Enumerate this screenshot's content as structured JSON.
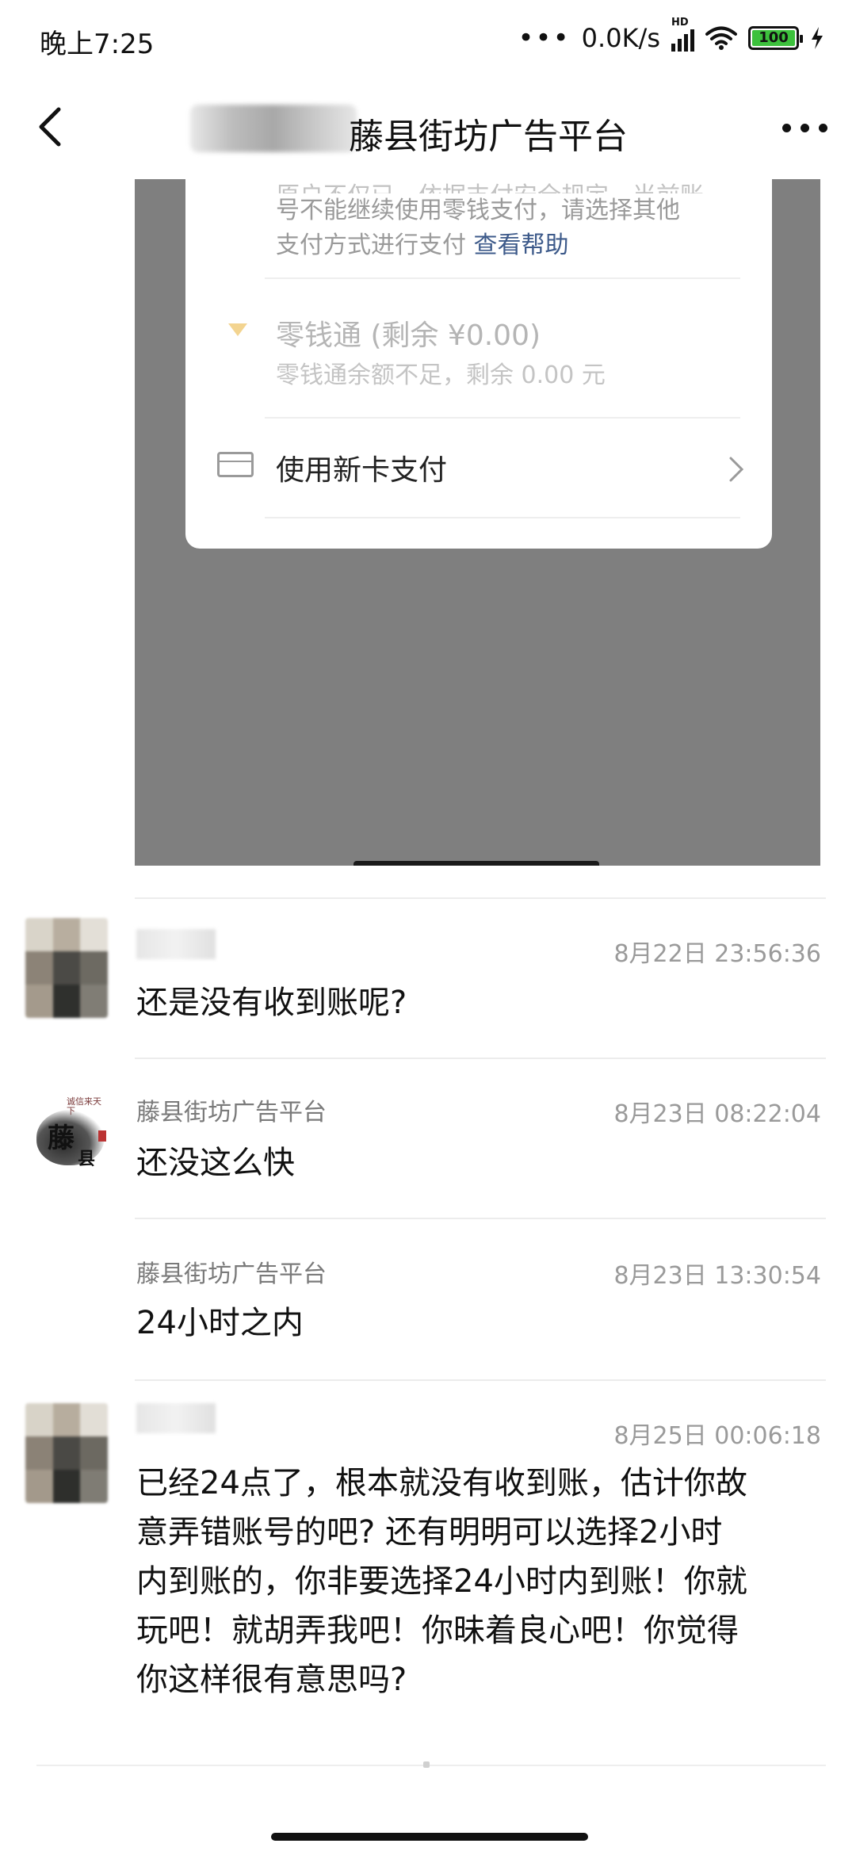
{
  "status_bar": {
    "time": "晚上7:25",
    "dots": "•••",
    "network_speed": "0.0K/s",
    "hd_tag": "HD",
    "battery": "100"
  },
  "header": {
    "title": "藤县街坊广告平台"
  },
  "embedded_screenshot": {
    "partial_line": "原户不仅已，依据支付安全规定，当前账",
    "notice_line_1": "号不能继续使用零钱支付，请选择其他",
    "notice_line_2": "支付方式进行支付",
    "help_link": "查看帮助",
    "lingqiantong_title": "零钱通 (剩余 ¥0.00)",
    "lingqiantong_sub": "零钱通余额不足，剩余 0.00 元",
    "new_card_label": "使用新卡支付"
  },
  "messages": [
    {
      "sender": "",
      "time": "8月22日 23:56:36",
      "text": "还是没有收到账呢?"
    },
    {
      "sender": "藤县街坊广告平台",
      "time": "8月23日 08:22:04",
      "text": "还没这么快"
    },
    {
      "sender": "藤县街坊广告平台",
      "time": "8月23日 13:30:54",
      "text": "24小时之内"
    },
    {
      "sender": "",
      "time": "8月25日 00:06:18",
      "lines": [
        "已经24点了，根本就没有收到账，估计你故",
        "意弄错账号的吧? 还有明明可以选择2小时",
        "内到账的，你非要选择24小时内到账！你就",
        "玩吧！就胡弄我吧！你昧着良心吧！你觉得",
        "你这样很有意思吗?"
      ]
    }
  ],
  "logo": {
    "char_1": "藤",
    "char_2": "县",
    "top_text": "诚信来天下"
  }
}
